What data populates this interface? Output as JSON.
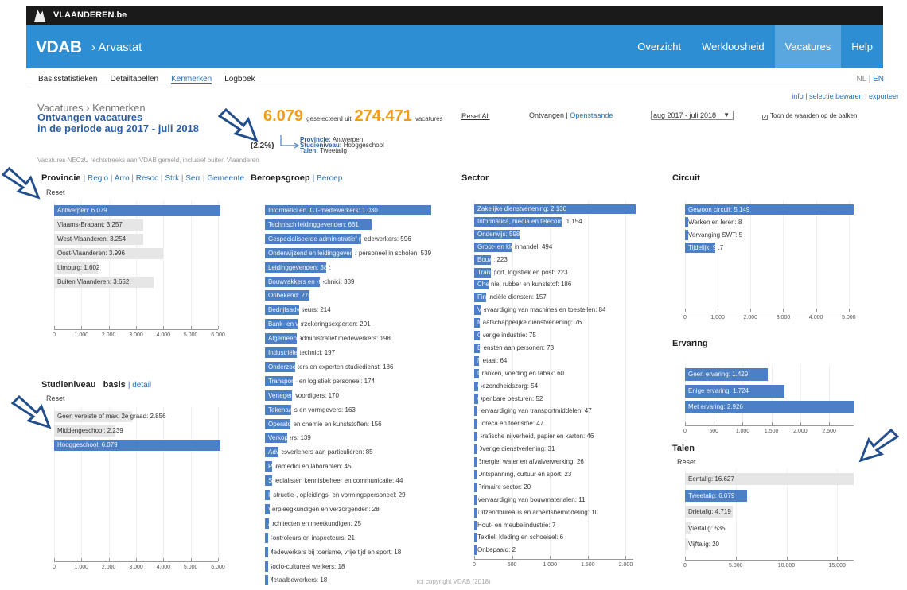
{
  "top_bar": {
    "brand": "VLAANDEREN.be"
  },
  "header": {
    "logo": "VDAB",
    "breadcrumb": "› Arvastat",
    "nav": [
      {
        "label": "Overzicht",
        "active": false
      },
      {
        "label": "Werkloosheid",
        "active": false
      },
      {
        "label": "Vacatures",
        "active": true
      },
      {
        "label": "Help",
        "active": false
      }
    ]
  },
  "subnav": [
    {
      "label": "Basisstatistieken",
      "active": false
    },
    {
      "label": "Detailtabellen",
      "active": false
    },
    {
      "label": "Kenmerken",
      "active": true
    },
    {
      "label": "Logboek",
      "active": false
    }
  ],
  "lang": {
    "nl": "NL",
    "sep": " | ",
    "en": "EN"
  },
  "actions": {
    "info": "info",
    "save": "selectie bewaren",
    "export": "exporteer"
  },
  "title": {
    "line1": "Vacatures › Kenmerken",
    "line2": "Ontvangen vacatures",
    "line3": "in de periode aug 2017 - juli 2018"
  },
  "note": "Vacatures NECzU rechtstreeks aan VDAB gemeld, inclusief buiten Vlaanderen",
  "selection": {
    "selected": "6.079",
    "selected_mid": "geselecteerd uit",
    "total": "274.471",
    "total_label": "vacatures",
    "pct": "(2,2%)",
    "filters": [
      {
        "key": "Provincie",
        "value": "Antwerpen"
      },
      {
        "key": "Studieniveau",
        "value": "Hooggeschool"
      },
      {
        "key": "Talen",
        "value": "Tweetalig"
      }
    ]
  },
  "controls": {
    "reset_all": "Reset All",
    "ontvangen": "Ontvangen",
    "openstaande": "Openstaande",
    "period": "aug 2017 - juli 2018",
    "toon": "Toon de waarden op de balken",
    "toon_checked": true
  },
  "panels": {
    "provincie": {
      "title": "Provincie",
      "links": [
        "Regio",
        "Arro",
        "Resoc",
        "Strk",
        "Serr",
        "Gemeente"
      ],
      "reset": "Reset"
    },
    "studie": {
      "title": "Studieniveau",
      "sub": "basis",
      "link": "detail",
      "reset": "Reset"
    },
    "beroep": {
      "title": "Beroepsgroep",
      "link": "Beroep"
    },
    "sector": {
      "title": "Sector"
    },
    "circuit": {
      "title": "Circuit"
    },
    "ervaring": {
      "title": "Ervaring"
    },
    "talen": {
      "title": "Talen",
      "reset": "Reset"
    }
  },
  "colors": {
    "selected_bar": "#4b7fc6",
    "bar": "#e6e6e6",
    "accent_orange": "#f39c12",
    "header_blue": "#2d8ed3"
  },
  "chart_data": [
    {
      "id": "provincie",
      "type": "bar",
      "orientation": "horizontal",
      "categories": [
        "Antwerpen",
        "Vlaams-Brabant",
        "West-Vlaanderen",
        "Oost-Vlaanderen",
        "Limburg",
        "Buiten Vlaanderen"
      ],
      "values": [
        6079,
        3257,
        3254,
        3996,
        1602,
        3652
      ],
      "labels": [
        "Antwerpen: 6.079",
        "Vlaams-Brabant: 3.257",
        "West-Vlaanderen: 3.254",
        "Oost-Vlaanderen: 3.996",
        "Limburg: 1.602",
        "Buiten Vlaanderen: 3.652"
      ],
      "selected": [
        0
      ],
      "xlim": [
        0,
        6000
      ],
      "ticks": [
        "0",
        "1.000",
        "2.000",
        "3.000",
        "4.000",
        "5.000",
        "6.000"
      ],
      "tick_values": [
        0,
        1000,
        2000,
        3000,
        4000,
        5000,
        6000
      ]
    },
    {
      "id": "studie",
      "type": "bar",
      "orientation": "horizontal",
      "categories": [
        "Geen vereiste of max. 2e graad",
        "Middengeschool",
        "Hooggeschool"
      ],
      "values": [
        2856,
        2239,
        6079
      ],
      "labels": [
        "Geen vereiste of max. 2e graad: 2.856",
        "Middengeschool: 2.239",
        "Hooggeschool: 6.079"
      ],
      "selected": [
        2
      ],
      "xlim": [
        0,
        6000
      ],
      "ticks": [
        "0",
        "1.000",
        "2.000",
        "3.000",
        "4.000",
        "5.000",
        "6.000"
      ],
      "tick_values": [
        0,
        1000,
        2000,
        3000,
        4000,
        5000,
        6000
      ]
    },
    {
      "id": "beroep",
      "type": "bar",
      "orientation": "horizontal",
      "values": [
        1030,
        661,
        596,
        539,
        382,
        339,
        276,
        214,
        201,
        198,
        197,
        186,
        174,
        170,
        163,
        156,
        139,
        85,
        45,
        44,
        29,
        28,
        25,
        21,
        18,
        18,
        18
      ],
      "labels": [
        "Informatici en ICT-medewerkers: 1.030",
        "Technisch leidinggevenden: 661",
        "Gespecialiseerde administratief medewerkers: 596",
        "Onderwijzend en leidinggevend personeel in scholen: 539",
        "Leidinggevenden: 382",
        "Bouwvakkers en -technici: 339",
        "Onbekend: 276",
        "Bedrijfsadviseurs: 214",
        "Bank- en verzekeringsexperten: 201",
        "Algemeen administratief medewerkers: 198",
        "Industriële technici: 197",
        "Onderzoekers en experten studiedienst: 186",
        "Transport- en logistiek personeel: 174",
        "Vertegenwoordigers: 170",
        "Tekenaars en vormgevers: 163",
        "Operatoren chemie en kunststoffen: 156",
        "Verkopers: 139",
        "Adviesverleners aan particulieren: 85",
        "Paramedici en laboranten: 45",
        "Specialisten kennisbeheer en communicatie: 44",
        "Instructie-, opleidings- en vormingspersoneel: 29",
        "Verpleegkundigen en verzorgenden: 28",
        "Architecten en meetkundigen: 25",
        "Controleurs en inspecteurs: 21",
        "Medewerkers bij toerisme, vrije tijd en sport: 18",
        "Socio-cultureel werkers: 18",
        "Metaalbewerkers: 18"
      ],
      "xlim": [
        0,
        1050
      ],
      "ticks": [],
      "tick_values": []
    },
    {
      "id": "sector",
      "type": "bar",
      "orientation": "horizontal",
      "values": [
        2130,
        1154,
        598,
        494,
        223,
        223,
        186,
        157,
        84,
        76,
        75,
        73,
        64,
        60,
        54,
        52,
        47,
        47,
        46,
        31,
        26,
        23,
        20,
        11,
        10,
        7,
        6,
        2
      ],
      "labels": [
        "Zakelijke dienstverlening: 2.130",
        "Informatica, media en telecom: 1.154",
        "Onderwijs: 598",
        "Groot- en kleinhandel: 494",
        "Bouw: 223",
        "Transport, logistiek en post: 223",
        "Chemie, rubber en kunststof: 186",
        "Financiële diensten: 157",
        "Vervaardiging van machines en toestellen: 84",
        "Maatschappelijke dienstverlening: 76",
        "Overige industrie: 75",
        "Diensten aan personen: 73",
        "Metaal: 64",
        "Dranken, voeding en tabak: 60",
        "Gezondheidszorg: 54",
        "Openbare besturen: 52",
        "Vervaardiging van transportmiddelen: 47",
        "Horeca en toerisme: 47",
        "Grafische nijverheid, papier en karton: 46",
        "Overige dienstverlening: 31",
        "Energie, water en afvalverwerking: 26",
        "Ontspanning, cultuur en sport: 23",
        "Primaire sector: 20",
        "Vervaardiging van bouwmaterialen: 11",
        "Uitzendbureaus en arbeidsbemiddeling: 10",
        "Hout- en meubelindustrie: 7",
        "Textiel, kleding en schoeisel: 6",
        "Onbepaald: 2"
      ],
      "xlim": [
        0,
        2100
      ],
      "ticks": [
        "0",
        "500",
        "1.000",
        "1.500",
        "2.000"
      ],
      "tick_values": [
        0,
        500,
        1000,
        1500,
        2000
      ]
    },
    {
      "id": "circuit",
      "type": "bar",
      "orientation": "horizontal",
      "values": [
        5149,
        8,
        5,
        917
      ],
      "labels": [
        "Gewoon circuit: 5.149",
        "Werken en leren: 8",
        "Vervanging SWT: 5",
        "Tijdelijk: 917"
      ],
      "xlim": [
        0,
        5150
      ],
      "ticks": [
        "0",
        "1.000",
        "2.000",
        "3.000",
        "4.000",
        "5.000"
      ],
      "tick_values": [
        0,
        1000,
        2000,
        3000,
        4000,
        5000
      ]
    },
    {
      "id": "ervaring",
      "type": "bar",
      "orientation": "horizontal",
      "values": [
        1429,
        1724,
        2926
      ],
      "labels": [
        "Geen ervaring: 1.429",
        "Enige ervaring: 1.724",
        "Met ervaring: 2.926"
      ],
      "xlim": [
        0,
        2926
      ],
      "ticks": [
        "0",
        "500",
        "1.000",
        "1.500",
        "2.000",
        "2.500"
      ],
      "tick_values": [
        0,
        500,
        1000,
        1500,
        2000,
        2500
      ]
    },
    {
      "id": "talen",
      "type": "bar",
      "orientation": "horizontal",
      "values": [
        16627,
        6079,
        4719,
        535,
        20
      ],
      "labels": [
        "Eentalig: 16.627",
        "Tweetalig: 6.079",
        "Drietalig: 4.719",
        "Viertalig: 535",
        "Vijftalig: 20"
      ],
      "selected": [
        1
      ],
      "xlim": [
        0,
        16627
      ],
      "ticks": [
        "0",
        "5.000",
        "10.000",
        "15.000"
      ],
      "tick_values": [
        0,
        5000,
        10000,
        15000
      ]
    }
  ],
  "footer": "(c) copyright VDAB (2018)"
}
